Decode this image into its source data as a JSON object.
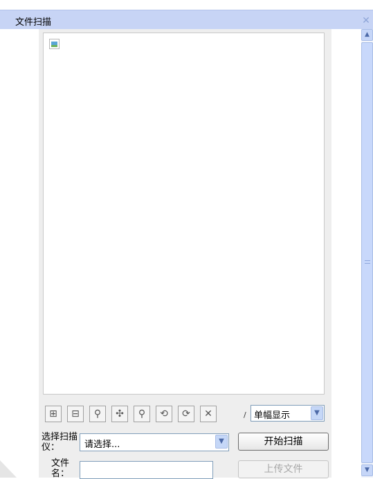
{
  "window": {
    "title": "文件扫描"
  },
  "toolbar": {
    "buttons": [
      {
        "name": "add-image-icon",
        "glyph": "⊞"
      },
      {
        "name": "remove-image-icon",
        "glyph": "⊟"
      },
      {
        "name": "zoom-in-icon",
        "glyph": "⚲"
      },
      {
        "name": "fit-icon",
        "glyph": "✣"
      },
      {
        "name": "zoom-out-icon",
        "glyph": "⚲"
      },
      {
        "name": "rotate-left-icon",
        "glyph": "⟲"
      },
      {
        "name": "rotate-right-icon",
        "glyph": "⟳"
      },
      {
        "name": "delete-icon",
        "glyph": "✕"
      }
    ],
    "page_separator": "/",
    "view_mode": "单幅显示"
  },
  "form": {
    "scanner_label": "选择扫描仪：",
    "scanner_value": "请选择...",
    "scan_button": "开始扫描",
    "filename_label": "文件名：",
    "filename_value": "",
    "upload_button": "上传文件"
  },
  "colors": {
    "titlebar": "#c7d4f5",
    "panel": "#eeeeee",
    "accent": "#7f9db9"
  }
}
